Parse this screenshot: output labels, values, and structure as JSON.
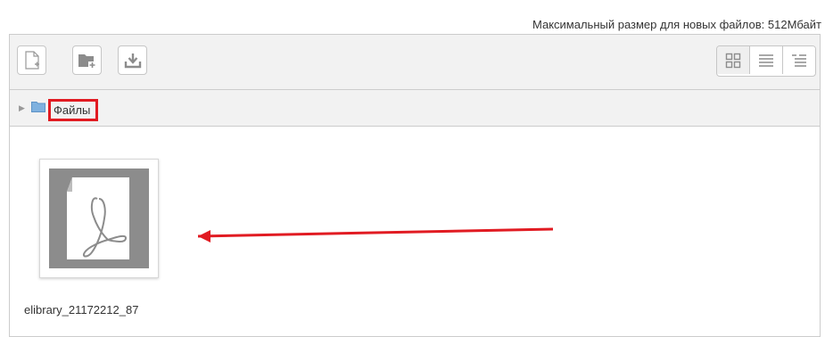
{
  "upload_limit": "Максимальный размер для новых файлов: 512Мбайт",
  "toolbar": {
    "buttons": [
      {
        "icon": "add-file-icon"
      },
      {
        "icon": "create-folder-icon"
      },
      {
        "icon": "download-icon"
      }
    ],
    "view_modes": [
      {
        "icon": "icons-view-icon",
        "selected": true
      },
      {
        "icon": "list-view-icon",
        "selected": false
      },
      {
        "icon": "tree-view-icon",
        "selected": false
      }
    ]
  },
  "path": {
    "folder_label": "Файлы"
  },
  "files": [
    {
      "name": "elibrary_21172212_87",
      "icon": "pdf-file-icon"
    }
  ],
  "colors": {
    "highlight": "#e11b22",
    "icon_gray": "#8c8c8c",
    "folder_blue": "#7fb1df"
  }
}
